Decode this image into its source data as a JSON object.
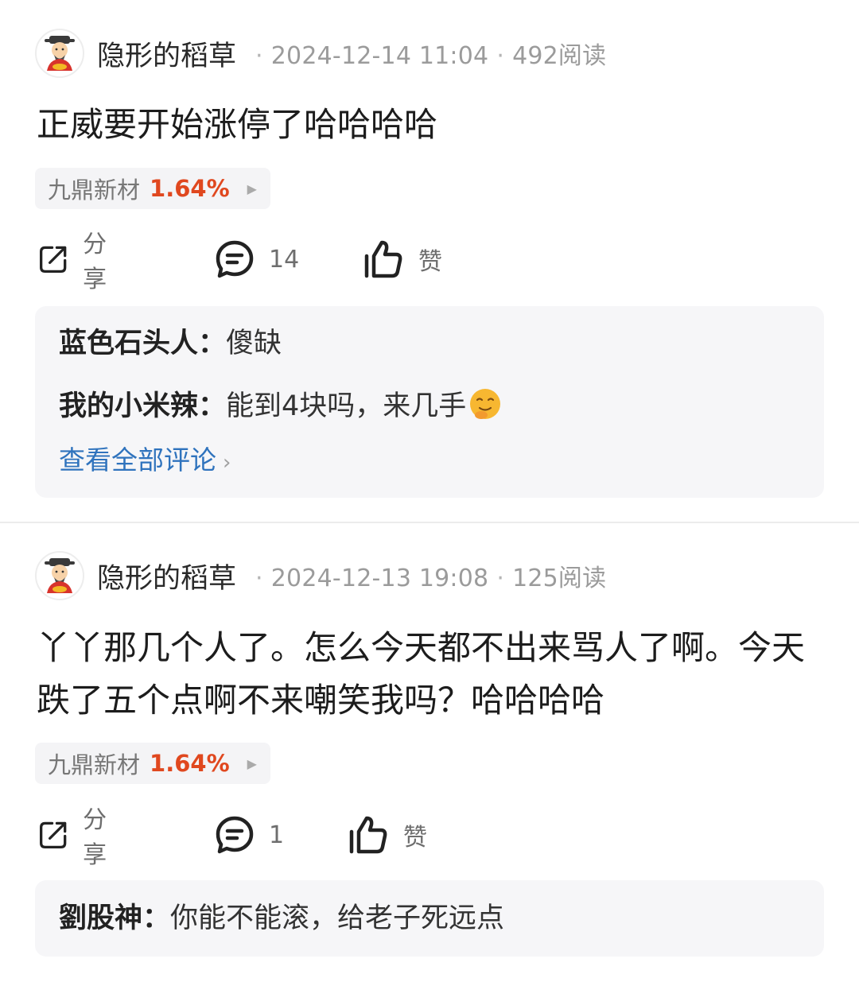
{
  "posts": [
    {
      "author": "隐形的稻草",
      "date": "2024-12-14 11:04",
      "reads": "492阅读",
      "content": "正威要开始涨停了哈哈哈哈",
      "stock": {
        "name": "九鼎新材",
        "change": "1.64%"
      },
      "actions": {
        "share": "分享",
        "comments": "14",
        "like": "赞"
      },
      "comments": [
        {
          "user": "蓝色石头人：",
          "text": "傻缺"
        },
        {
          "user": "我的小米辣：",
          "text": "能到4块吗，来几手"
        }
      ],
      "view_all": "查看全部评论"
    },
    {
      "author": "隐形的稻草",
      "date": "2024-12-13 19:08",
      "reads": "125阅读",
      "content": "丫丫那几个人了。怎么今天都不出来骂人了啊。今天跌了五个点啊不来嘲笑我吗？哈哈哈哈",
      "stock": {
        "name": "九鼎新材",
        "change": "1.64%"
      },
      "actions": {
        "share": "分享",
        "comments": "1",
        "like": "赞"
      },
      "comments": [
        {
          "user": "劉股神：",
          "text": "你能不能滚，给老子死远点"
        }
      ]
    }
  ],
  "colors": {
    "stock_change": "#e0481f",
    "link": "#2f73bd",
    "comment_bg": "#f6f6f8"
  },
  "icons": {
    "share": "share-icon",
    "comment": "comment-icon",
    "like": "thumbs-up-icon",
    "emoji": "smirk-emoji"
  }
}
